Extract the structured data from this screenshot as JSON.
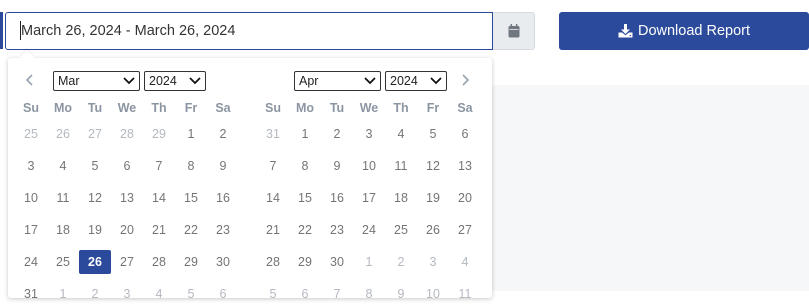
{
  "date_range": {
    "value": "March 26, 2024 - March 26, 2024"
  },
  "calendar_button": {
    "icon": "calendar-icon"
  },
  "download_button": {
    "label": "Download Report",
    "icon": "download-icon"
  },
  "colors": {
    "accent": "#2c4a9c",
    "muted_text": "#b4b9c0",
    "text": "#757575"
  },
  "calendars": [
    {
      "month": "Mar",
      "year": "2024",
      "weekdays": [
        "Su",
        "Mo",
        "Tu",
        "We",
        "Th",
        "Fr",
        "Sa"
      ],
      "weeks": [
        [
          "25",
          "26",
          "27",
          "28",
          "29",
          "1",
          "2"
        ],
        [
          "3",
          "4",
          "5",
          "6",
          "7",
          "8",
          "9"
        ],
        [
          "10",
          "11",
          "12",
          "13",
          "14",
          "15",
          "16"
        ],
        [
          "17",
          "18",
          "19",
          "20",
          "21",
          "22",
          "23"
        ],
        [
          "24",
          "25",
          "26",
          "27",
          "28",
          "29",
          "30"
        ],
        [
          "31",
          "1",
          "2",
          "3",
          "4",
          "5",
          "6"
        ]
      ],
      "outside_month": [
        [
          true,
          true,
          true,
          true,
          true,
          false,
          false
        ],
        [
          false,
          false,
          false,
          false,
          false,
          false,
          false
        ],
        [
          false,
          false,
          false,
          false,
          false,
          false,
          false
        ],
        [
          false,
          false,
          false,
          false,
          false,
          false,
          false
        ],
        [
          false,
          false,
          false,
          false,
          false,
          false,
          false
        ],
        [
          false,
          true,
          true,
          true,
          true,
          true,
          true
        ]
      ],
      "selected_day": "26"
    },
    {
      "month": "Apr",
      "year": "2024",
      "weekdays": [
        "Su",
        "Mo",
        "Tu",
        "We",
        "Th",
        "Fr",
        "Sa"
      ],
      "weeks": [
        [
          "31",
          "1",
          "2",
          "3",
          "4",
          "5",
          "6"
        ],
        [
          "7",
          "8",
          "9",
          "10",
          "11",
          "12",
          "13"
        ],
        [
          "14",
          "15",
          "16",
          "17",
          "18",
          "19",
          "20"
        ],
        [
          "21",
          "22",
          "23",
          "24",
          "25",
          "26",
          "27"
        ],
        [
          "28",
          "29",
          "30",
          "1",
          "2",
          "3",
          "4"
        ],
        [
          "5",
          "6",
          "7",
          "8",
          "9",
          "10",
          "11"
        ]
      ],
      "outside_month": [
        [
          true,
          false,
          false,
          false,
          false,
          false,
          false
        ],
        [
          false,
          false,
          false,
          false,
          false,
          false,
          false
        ],
        [
          false,
          false,
          false,
          false,
          false,
          false,
          false
        ],
        [
          false,
          false,
          false,
          false,
          false,
          false,
          false
        ],
        [
          false,
          false,
          false,
          true,
          true,
          true,
          true
        ],
        [
          true,
          true,
          true,
          true,
          true,
          true,
          true
        ]
      ],
      "selected_day": null
    }
  ]
}
